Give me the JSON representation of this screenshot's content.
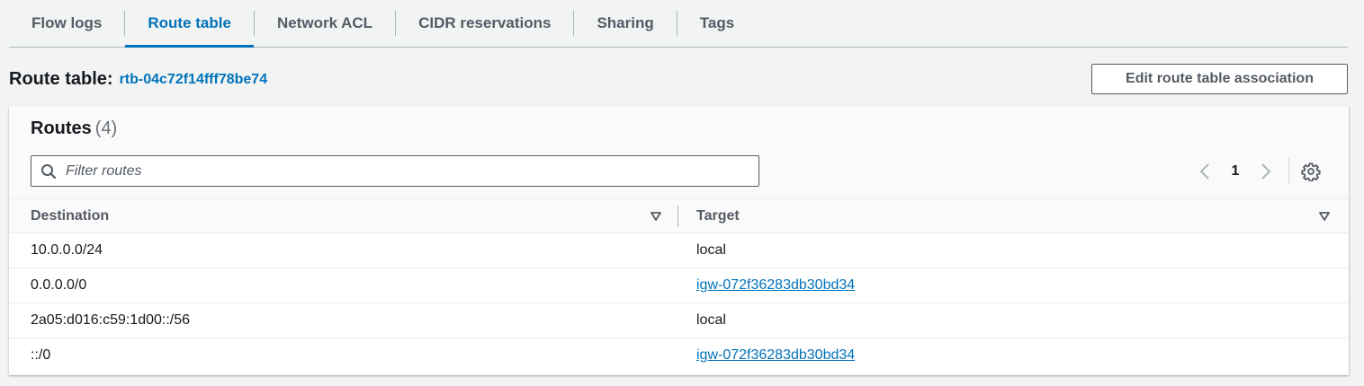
{
  "tabs": [
    {
      "label": "Flow logs",
      "active": false
    },
    {
      "label": "Route table",
      "active": true
    },
    {
      "label": "Network ACL",
      "active": false
    },
    {
      "label": "CIDR reservations",
      "active": false
    },
    {
      "label": "Sharing",
      "active": false
    },
    {
      "label": "Tags",
      "active": false
    }
  ],
  "route_table": {
    "title": "Route table:",
    "id": "rtb-04c72f14fff78be74",
    "edit_button_label": "Edit route table association"
  },
  "routes": {
    "title": "Routes",
    "count": "(4)",
    "filter_placeholder": "Filter routes",
    "page": "1",
    "columns": {
      "destination": "Destination",
      "target": "Target"
    },
    "rows": [
      {
        "destination": "10.0.0.0/24",
        "target": "local",
        "target_is_link": false
      },
      {
        "destination": "0.0.0.0/0",
        "target": "igw-072f36283db30bd34",
        "target_is_link": true
      },
      {
        "destination": "2a05:d016:c59:1d00::/56",
        "target": "local",
        "target_is_link": false
      },
      {
        "destination": "::/0",
        "target": "igw-072f36283db30bd34",
        "target_is_link": true
      }
    ]
  },
  "icons": {
    "search": "search-icon",
    "prev": "chevron-left-icon",
    "next": "chevron-right-icon",
    "settings": "gear-icon",
    "sort": "caret-down-icon"
  },
  "colors": {
    "accent": "#0073bb",
    "text": "#16191f",
    "muted": "#545b64",
    "background": "#f2f3f3"
  }
}
